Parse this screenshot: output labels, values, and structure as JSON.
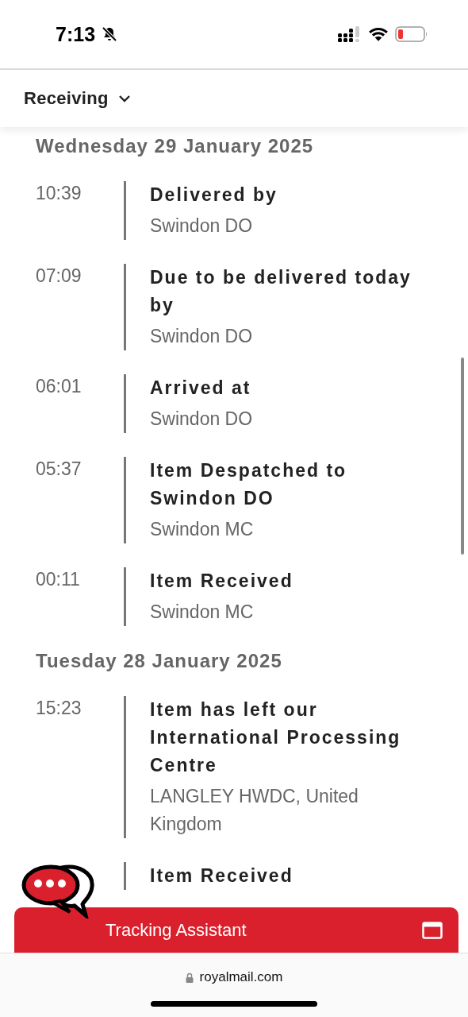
{
  "status_bar": {
    "time": "7:13",
    "silent": true
  },
  "header": {
    "dropdown": "Receiving"
  },
  "days": [
    {
      "date": "Wednesday 29 January 2025",
      "events": [
        {
          "time": "10:39",
          "title": "Delivered by",
          "location": "Swindon DO"
        },
        {
          "time": "07:09",
          "title": "Due to be delivered today by",
          "location": "Swindon DO"
        },
        {
          "time": "06:01",
          "title": "Arrived at",
          "location": "Swindon DO"
        },
        {
          "time": "05:37",
          "title": "Item Despatched to Swindon DO",
          "location": "Swindon MC"
        },
        {
          "time": "00:11",
          "title": "Item Received",
          "location": "Swindon MC"
        }
      ]
    },
    {
      "date": "Tuesday 28 January 2025",
      "events": [
        {
          "time": "15:23",
          "title": "Item has left our International Processing Centre",
          "location": "LANGLEY HWDC, United Kingdom"
        },
        {
          "title": "Item Received"
        }
      ]
    }
  ],
  "assistant": {
    "label": "Tracking Assistant"
  },
  "address_bar": {
    "url": "royalmail.com"
  }
}
